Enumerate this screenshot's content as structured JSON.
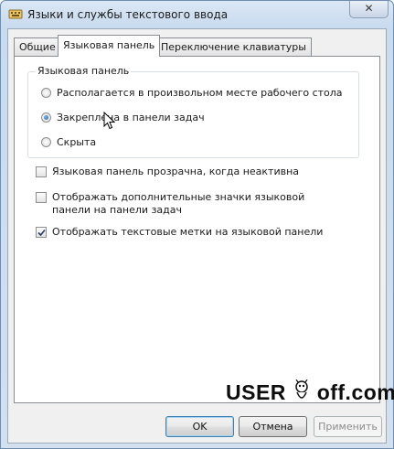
{
  "window": {
    "title": "Языки и службы текстового ввода",
    "close_glyph": "✕"
  },
  "tabs": [
    {
      "label": "Общие",
      "active": false
    },
    {
      "label": "Языковая панель",
      "active": true
    },
    {
      "label": "Переключение клавиатуры",
      "active": false
    }
  ],
  "language_bar_group": {
    "title": "Языковая панель",
    "options": [
      {
        "label": "Располагается в произвольном месте рабочего стола",
        "selected": false
      },
      {
        "label": "Закреплена в панели задач",
        "selected": true
      },
      {
        "label": "Скрыта",
        "selected": false
      }
    ]
  },
  "checkboxes": [
    {
      "label": "Языковая панель прозрачна, когда неактивна",
      "checked": false
    },
    {
      "label": "Отображать дополнительные значки языковой панели на панели задач",
      "checked": false
    },
    {
      "label": "Отображать текстовые метки на языковой панели",
      "checked": true
    }
  ],
  "watermark": {
    "part1": "USER",
    "part2": "off.com"
  },
  "buttons": {
    "ok": "OK",
    "cancel": "Отмена",
    "apply": "Применить"
  },
  "colors": {
    "accent": "#3c7fb1",
    "title_bar": "#c9dbef"
  }
}
